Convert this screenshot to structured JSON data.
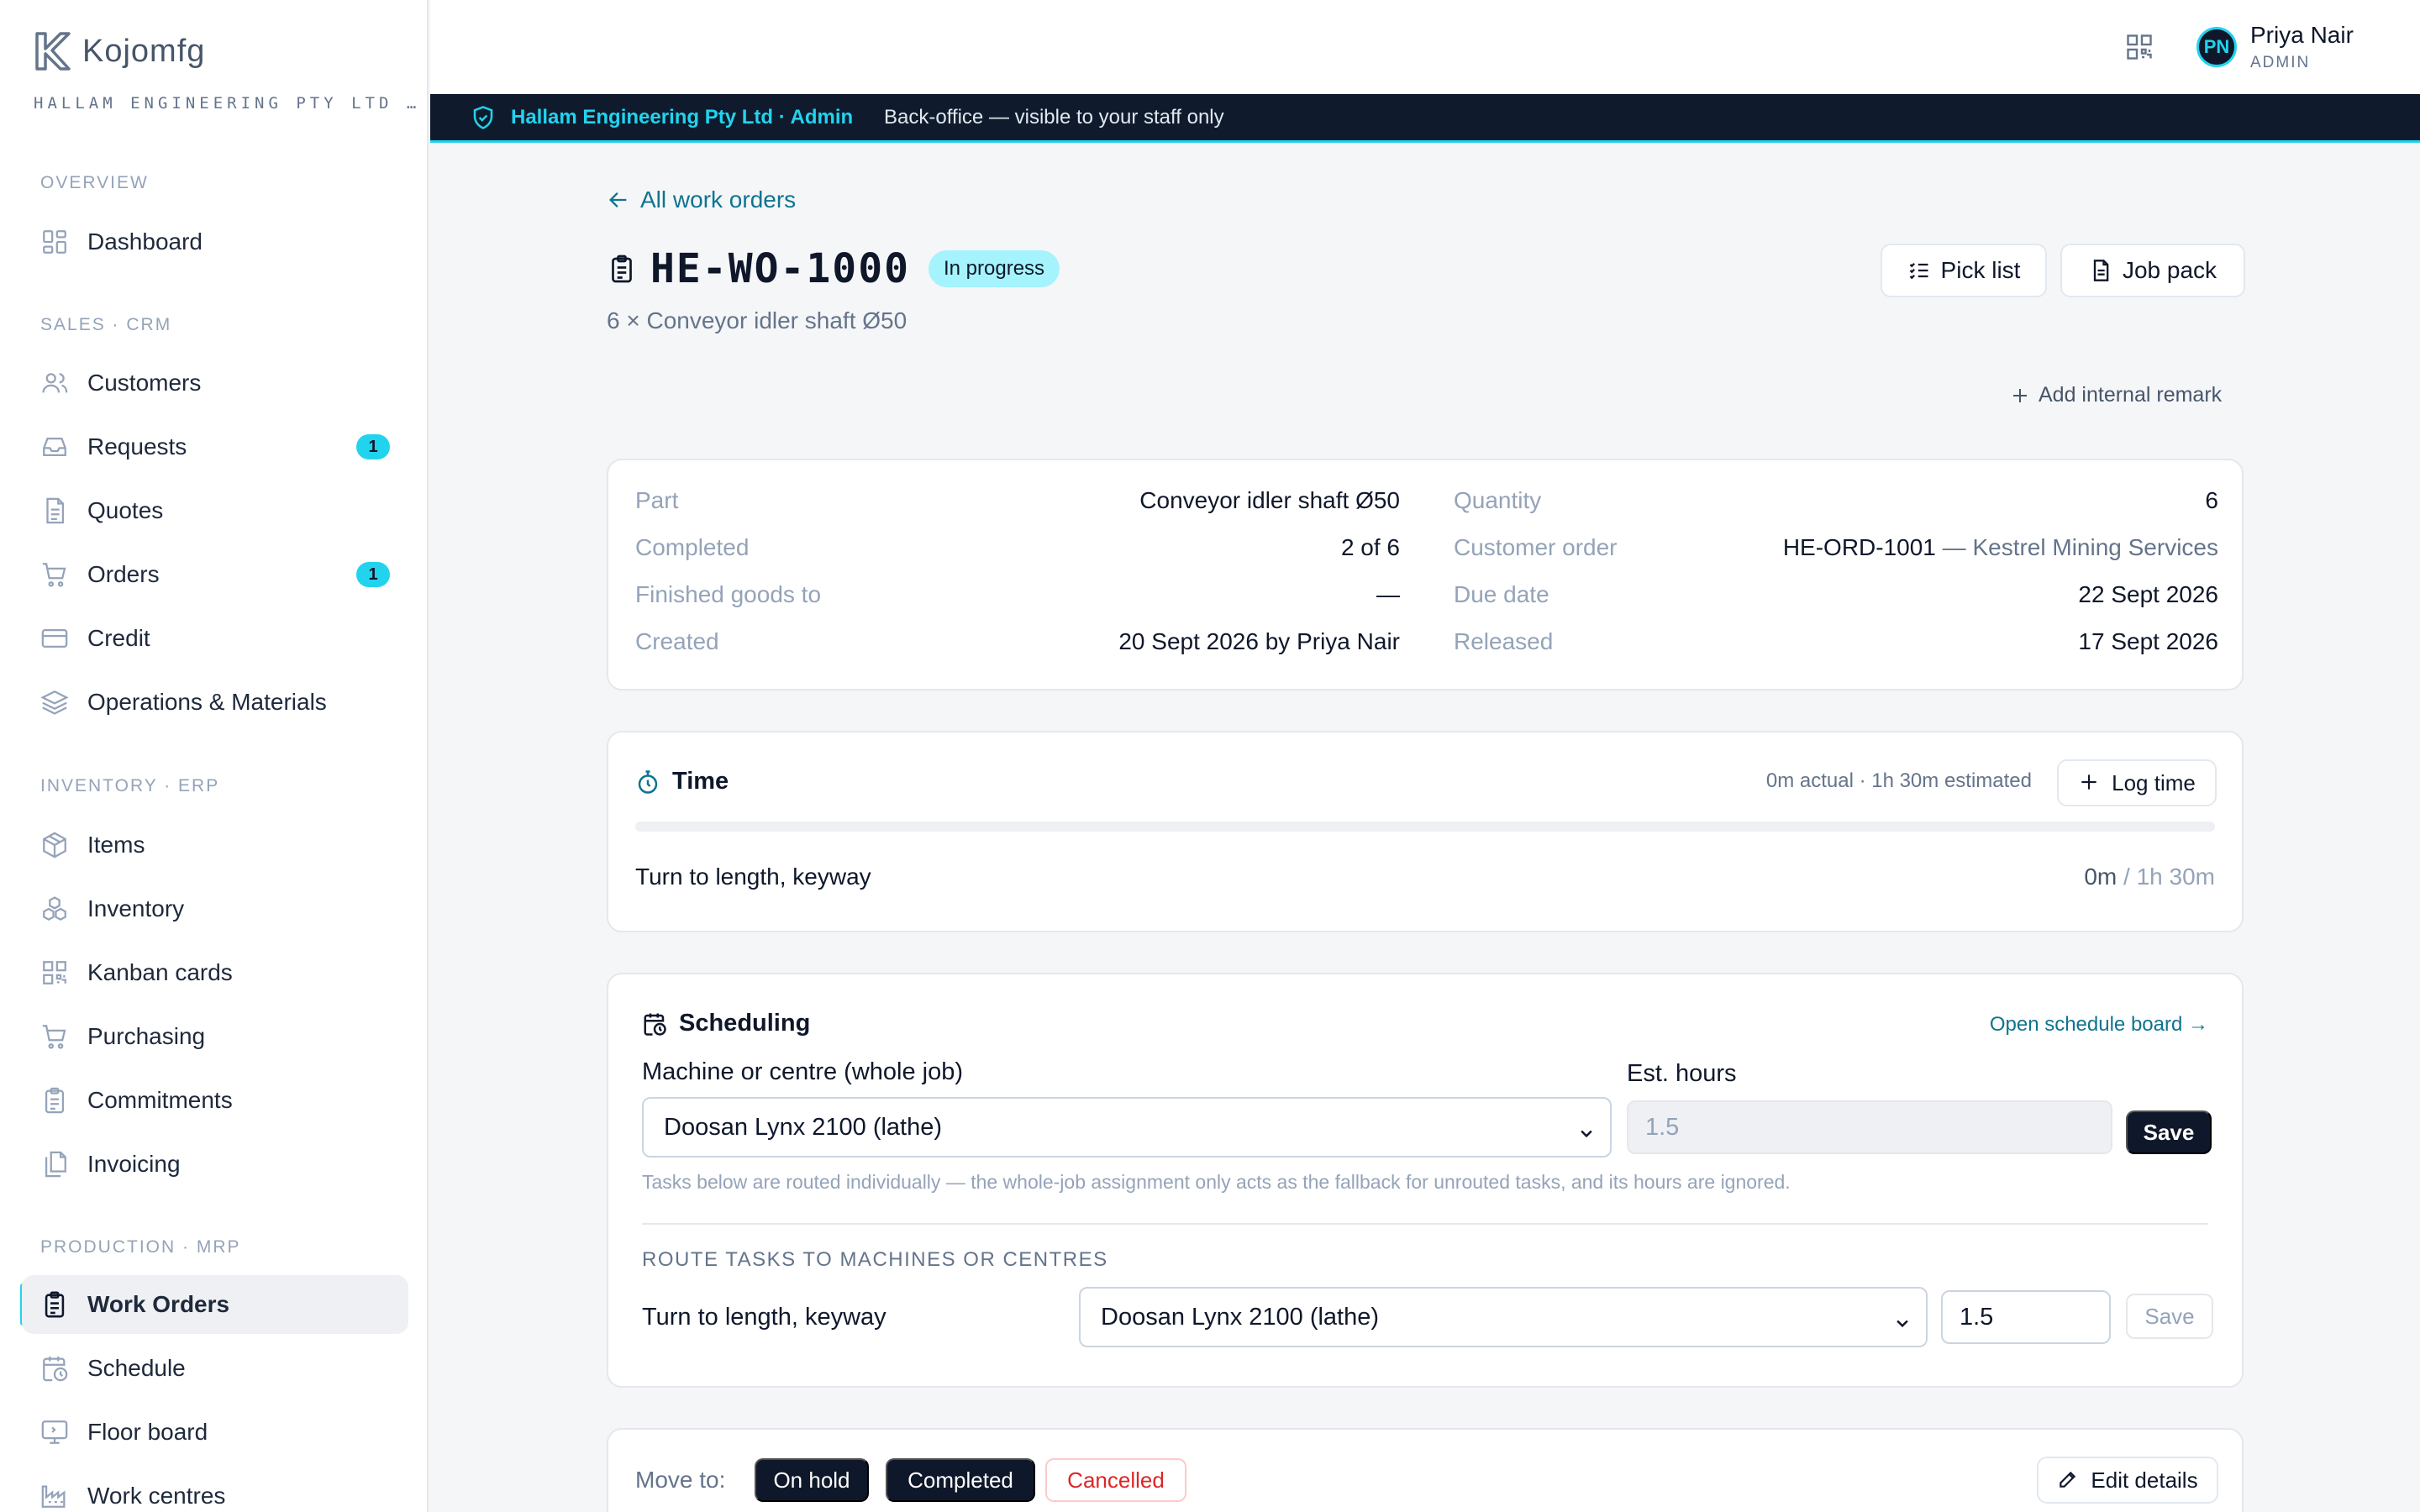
{
  "brand": {
    "name": "Kojomfg",
    "company": "HALLAM ENGINEERING PTY LTD …"
  },
  "sidebar": {
    "sections": [
      {
        "title": "OVERVIEW",
        "items": [
          {
            "label": "Dashboard",
            "icon": "dashboard-icon"
          }
        ]
      },
      {
        "title": "SALES · CRM",
        "items": [
          {
            "label": "Customers",
            "icon": "users-icon"
          },
          {
            "label": "Requests",
            "icon": "inbox-icon",
            "badge": "1"
          },
          {
            "label": "Quotes",
            "icon": "document-icon"
          },
          {
            "label": "Orders",
            "icon": "cart-icon",
            "badge": "1"
          },
          {
            "label": "Credit",
            "icon": "credit-card-icon"
          },
          {
            "label": "Operations & Materials",
            "icon": "layers-icon"
          }
        ]
      },
      {
        "title": "INVENTORY · ERP",
        "items": [
          {
            "label": "Items",
            "icon": "package-icon"
          },
          {
            "label": "Inventory",
            "icon": "boxes-icon"
          },
          {
            "label": "Kanban cards",
            "icon": "qr-icon"
          },
          {
            "label": "Purchasing",
            "icon": "cart-icon"
          },
          {
            "label": "Commitments",
            "icon": "clipboard-icon"
          },
          {
            "label": "Invoicing",
            "icon": "files-icon"
          }
        ]
      },
      {
        "title": "PRODUCTION · MRP",
        "items": [
          {
            "label": "Work Orders",
            "icon": "clipboard-icon",
            "active": true
          },
          {
            "label": "Schedule",
            "icon": "calendar-clock-icon"
          },
          {
            "label": "Floor board",
            "icon": "monitor-icon"
          },
          {
            "label": "Work centres",
            "icon": "factory-icon"
          }
        ]
      }
    ]
  },
  "header": {
    "user_initials": "PN",
    "user_name": "Priya Nair",
    "user_role": "ADMIN"
  },
  "banner": {
    "strong": "Hallam Engineering Pty Ltd · Admin",
    "text": "Back-office — visible to your staff only"
  },
  "work_order": {
    "back_label": "All work orders",
    "number": "HE-WO-1000",
    "status": "In progress",
    "subtitle": "6 × Conveyor idler shaft Ø50",
    "pick_list_label": "Pick list",
    "job_pack_label": "Job pack",
    "remark_label": "Add internal remark",
    "details": {
      "left": [
        {
          "label": "Part",
          "value": "Conveyor idler shaft Ø50"
        },
        {
          "label": "Completed",
          "value": "2 of 6"
        },
        {
          "label": "Finished goods to",
          "value": "—"
        },
        {
          "label": "Created",
          "value": "20 Sept 2026 by Priya Nair"
        }
      ],
      "right": [
        {
          "label": "Quantity",
          "value": "6"
        },
        {
          "label": "Customer order",
          "value": "HE-ORD-1001",
          "extra": " — Kestrel Mining Services"
        },
        {
          "label": "Due date",
          "value": "22 Sept 2026"
        },
        {
          "label": "Released",
          "value": "17 Sept 2026"
        }
      ]
    },
    "time": {
      "title": "Time",
      "summary": "0m actual · 1h 30m estimated",
      "log_label": "Log time",
      "progress_fraction": 0,
      "task_name": "Turn to length, keyway",
      "task_actual": "0m",
      "task_estimate": " / 1h 30m"
    },
    "scheduling": {
      "title": "Scheduling",
      "board_link": "Open schedule board →",
      "machine_label": "Machine or centre (whole job)",
      "machine_value": "Doosan Lynx 2100 (lathe)",
      "hours_label": "Est. hours",
      "hours_placeholder": "1.5",
      "save_label": "Save",
      "hint": "Tasks below are routed individually — the whole-job assignment only acts as the fallback for unrouted tasks, and its hours are ignored.",
      "route_heading": "ROUTE TASKS TO MACHINES OR CENTRES",
      "task_name": "Turn to length, keyway",
      "task_machine": "Doosan Lynx 2100 (lathe)",
      "task_hours": "1.5",
      "task_save_label": "Save"
    },
    "actions": {
      "move_to_label": "Move to:",
      "on_hold": "On hold",
      "completed": "Completed",
      "cancelled": "Cancelled",
      "edit_label": "Edit details"
    }
  },
  "colors": {
    "accent": "#22d3ee",
    "navy": "#0f1b2d",
    "link": "#0e7490",
    "danger": "#dc2626"
  }
}
